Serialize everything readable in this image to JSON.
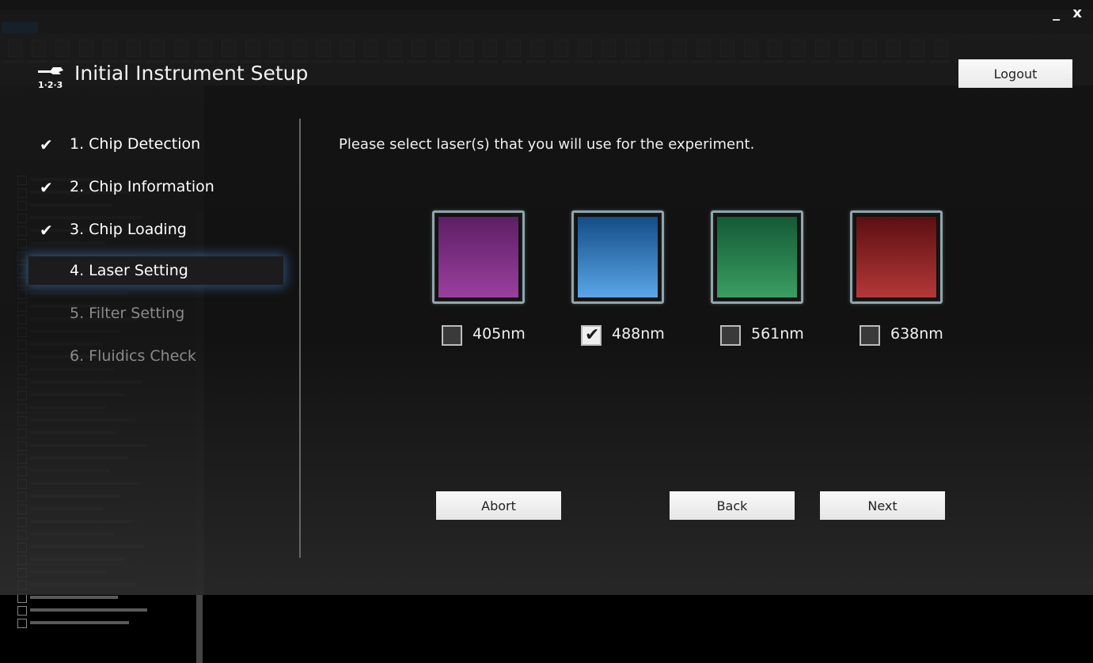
{
  "window": {
    "minimize_glyph": "_",
    "close_glyph": "x"
  },
  "dialog": {
    "title": "Initial Instrument Setup",
    "icon": "wrench-123-icon",
    "icon_caption": "1·2·3",
    "logout_label": "Logout"
  },
  "steps": [
    {
      "label": "1. Chip Detection",
      "state": "done",
      "check": "✔"
    },
    {
      "label": "2. Chip Information",
      "state": "done",
      "check": "✔"
    },
    {
      "label": "3. Chip Loading",
      "state": "done",
      "check": "✔"
    },
    {
      "label": "4. Laser Setting",
      "state": "current",
      "check": ""
    },
    {
      "label": "5. Filter Setting",
      "state": "pending",
      "check": ""
    },
    {
      "label": "6. Fluidics Check",
      "state": "pending",
      "check": ""
    }
  ],
  "main": {
    "instruction": "Please select laser(s) that you will use for the experiment."
  },
  "lasers": [
    {
      "label": "405nm",
      "checked": false,
      "color_top": "#5d1f63",
      "color_bottom": "#9a3fa0"
    },
    {
      "label": "488nm",
      "checked": true,
      "tick": "✔",
      "color_top": "#134c86",
      "color_bottom": "#5aa6e8"
    },
    {
      "label": "561nm",
      "checked": false,
      "color_top": "#135a35",
      "color_bottom": "#3b9e62"
    },
    {
      "label": "638nm",
      "checked": false,
      "color_top": "#5c0f12",
      "color_bottom": "#b43837"
    }
  ],
  "actions": {
    "abort_label": "Abort",
    "back_label": "Back",
    "next_label": "Next"
  },
  "colors": {
    "accent_glow": "#4682c8",
    "done_text": "#ffffff",
    "pending_text": "#8a8a8a"
  }
}
